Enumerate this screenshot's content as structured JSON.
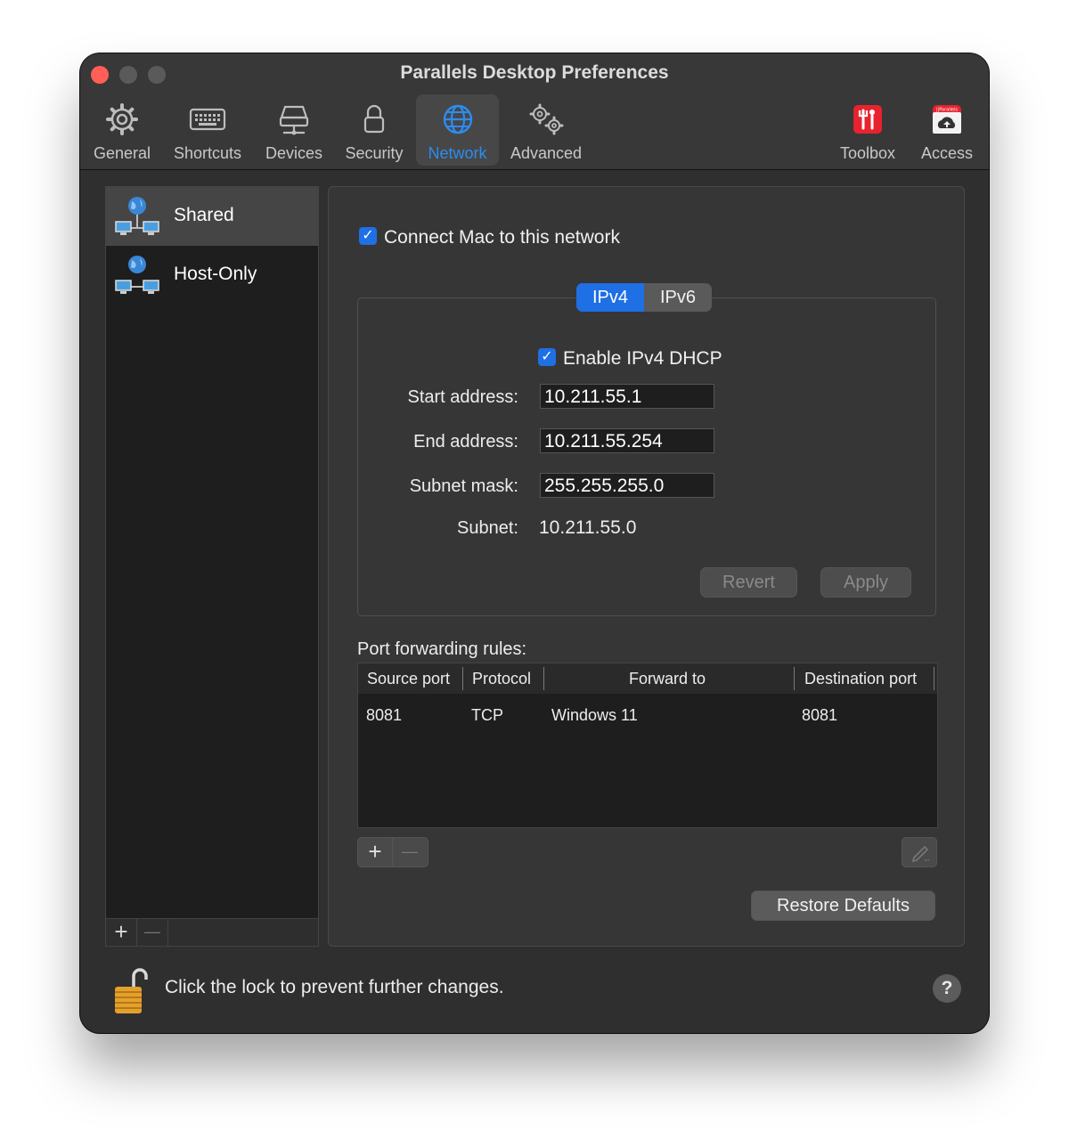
{
  "window": {
    "title": "Parallels Desktop Preferences"
  },
  "toolbar": {
    "items": [
      {
        "label": "General",
        "icon": "gear-icon"
      },
      {
        "label": "Shortcuts",
        "icon": "keyboard-icon"
      },
      {
        "label": "Devices",
        "icon": "drive-icon"
      },
      {
        "label": "Security",
        "icon": "lock-icon"
      },
      {
        "label": "Network",
        "icon": "globe-icon",
        "active": true
      },
      {
        "label": "Advanced",
        "icon": "gears-icon"
      },
      {
        "label": "Toolbox",
        "icon": "toolbox-icon"
      },
      {
        "label": "Access",
        "icon": "access-cloud-icon"
      }
    ],
    "access_badge": "||Parallels",
    "active_color": "#2d8cf0"
  },
  "sidebar": {
    "items": [
      {
        "label": "Shared",
        "selected": true
      },
      {
        "label": "Host-Only",
        "selected": false
      }
    ],
    "add_label": "+",
    "remove_label": "—"
  },
  "main": {
    "connect_mac_label": "Connect Mac to this network",
    "connect_mac_checked": true,
    "segments": {
      "ipv4": "IPv4",
      "ipv6": "IPv6",
      "selected": "IPv4"
    },
    "dhcp_label": "Enable IPv4 DHCP",
    "dhcp_checked": true,
    "start_label": "Start address:",
    "start_value": "10.211.55.1",
    "end_label": "End address:",
    "end_value": "10.211.55.254",
    "mask_label": "Subnet mask:",
    "mask_value": "255.255.255.0",
    "subnet_label": "Subnet:",
    "subnet_value": "10.211.55.0",
    "revert_label": "Revert",
    "apply_label": "Apply",
    "port_forwarding_label": "Port forwarding rules:",
    "table": {
      "columns": [
        "Source port",
        "Protocol",
        "Forward to",
        "Destination port"
      ],
      "rows": [
        {
          "source": "8081",
          "protocol": "TCP",
          "forward": "Windows 11",
          "destination": "8081"
        }
      ]
    },
    "add_rule_label": "+",
    "remove_rule_label": "—",
    "restore_label": "Restore Defaults",
    "accent": "#1f6fe5"
  },
  "footer": {
    "lock_text": "Click the lock to prevent further changes.",
    "help_label": "?"
  }
}
